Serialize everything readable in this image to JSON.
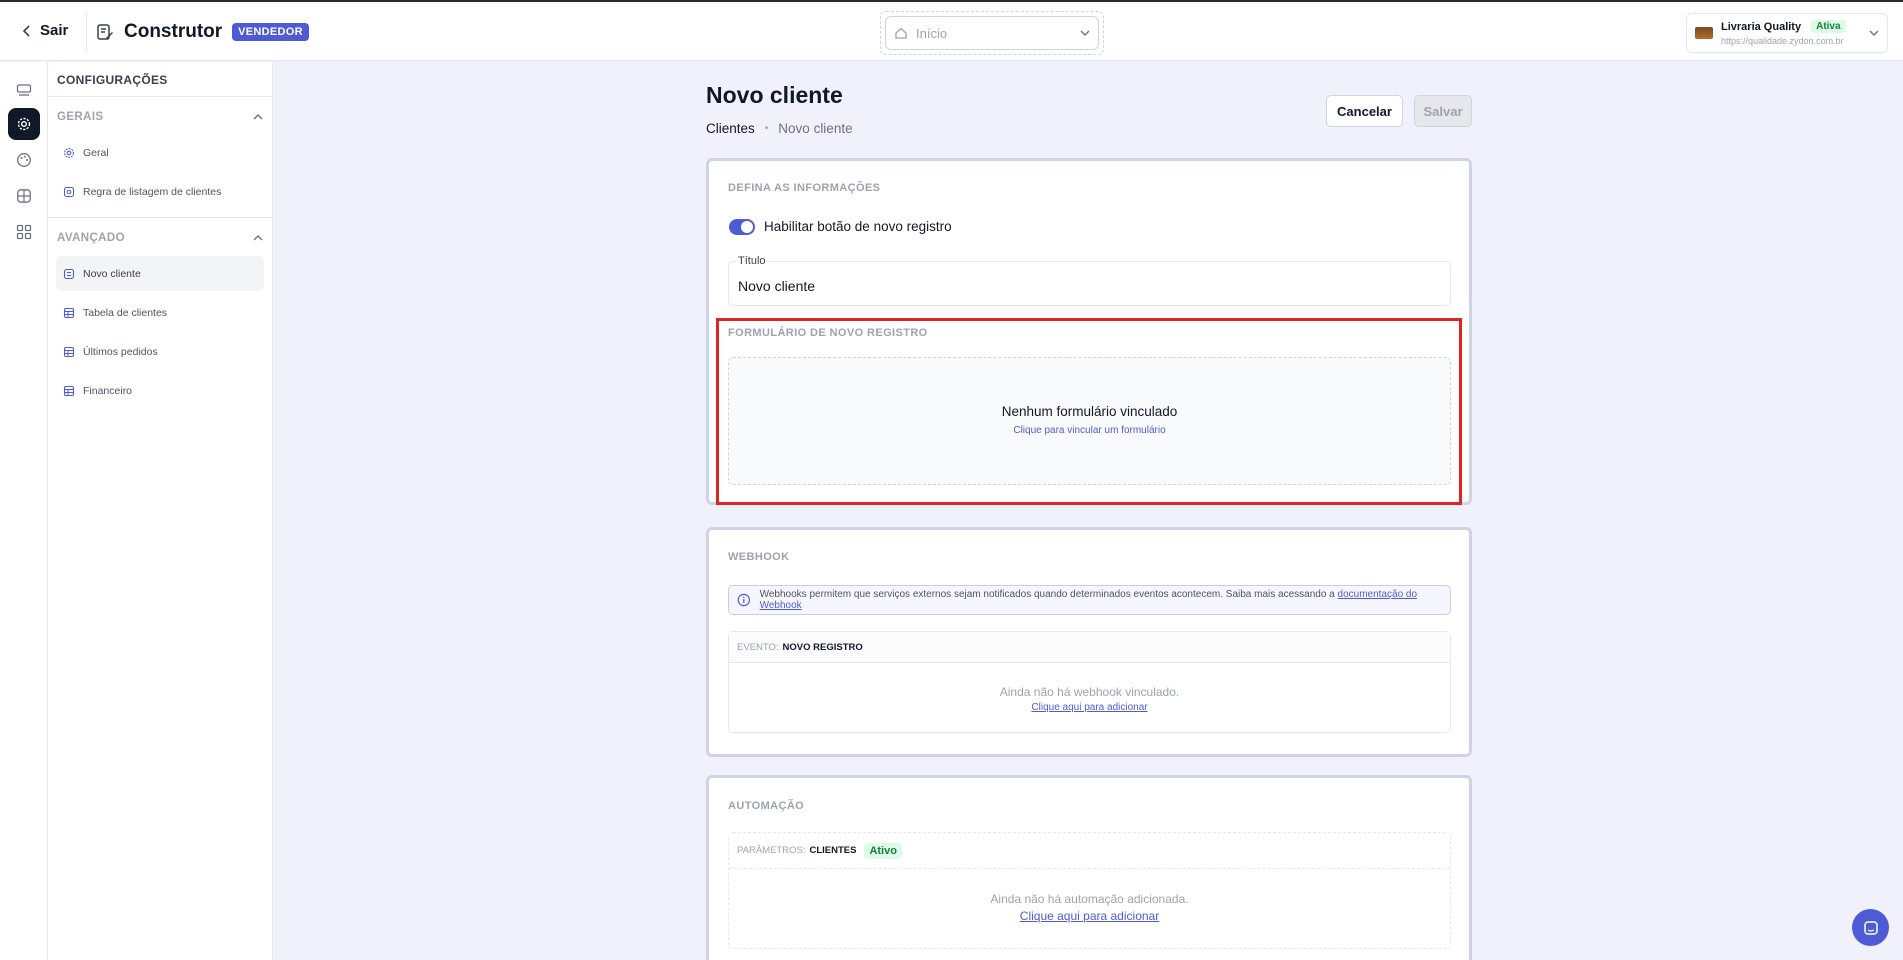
{
  "header": {
    "back_label": "Sair",
    "builder_title": "Construtor",
    "role_badge": "VENDEDOR",
    "page_select_value": "Início",
    "store": {
      "name": "Livraria Quality",
      "status": "Ativa",
      "url": "https://qualidade.zydon.com.br"
    }
  },
  "rail": {
    "icons": [
      "layers-icon",
      "gear-icon",
      "palette-icon",
      "globe-icon",
      "apps-grid-icon"
    ]
  },
  "sidebar": {
    "title": "CONFIGURAÇÕES",
    "groups": [
      {
        "label": "GERAIS",
        "items": [
          {
            "label": "Geral",
            "icon": "gear-icon"
          },
          {
            "label": "Regra de listagem de clientes",
            "icon": "rule-icon"
          }
        ]
      },
      {
        "label": "AVANÇADO",
        "items": [
          {
            "label": "Novo cliente",
            "icon": "form-icon",
            "active": true
          },
          {
            "label": "Tabela de clientes",
            "icon": "table-icon"
          },
          {
            "label": "Últimos pedidos",
            "icon": "table-icon"
          },
          {
            "label": "Financeiro",
            "icon": "table-icon"
          }
        ]
      }
    ]
  },
  "main": {
    "title": "Novo cliente",
    "breadcrumb": [
      "Clientes",
      "Novo cliente"
    ],
    "cancel_label": "Cancelar",
    "save_label": "Salvar",
    "info_section": {
      "label": "DEFINA AS INFORMAÇÕES",
      "toggle_label": "Habilitar botão de novo registro",
      "toggle_on": true,
      "title_field_label": "Título",
      "title_field_value": "Novo cliente",
      "form_label": "FORMULÁRIO DE NOVO REGISTRO",
      "form_empty_title": "Nenhum formulário vinculado",
      "form_empty_link": "Clique para vincular um formulário"
    },
    "webhook": {
      "label": "WEBHOOK",
      "info_text": "Webhooks permitem que serviços externos sejam notificados quando determinados eventos acontecem. Saiba mais acessando a",
      "info_link": "documentação do Webhook",
      "event_prefix": "EVENTO:",
      "event_name": "NOVO REGISTRO",
      "empty_text": "Ainda não há webhook vinculado.",
      "empty_link": "Clique aqui para adicionar"
    },
    "automation": {
      "label": "AUTOMAÇÃO",
      "param_prefix": "PARÂMETROS:",
      "param_name": "CLIENTES",
      "param_status": "Ativo",
      "empty_text": "Ainda não há automação adicionada.",
      "empty_link": "Clique aqui para adicionar"
    }
  },
  "colors": {
    "accent": "#4f5bd5",
    "highlight": "#dc2626",
    "success": "#15803d",
    "page_bg": "#f0f1fb"
  }
}
